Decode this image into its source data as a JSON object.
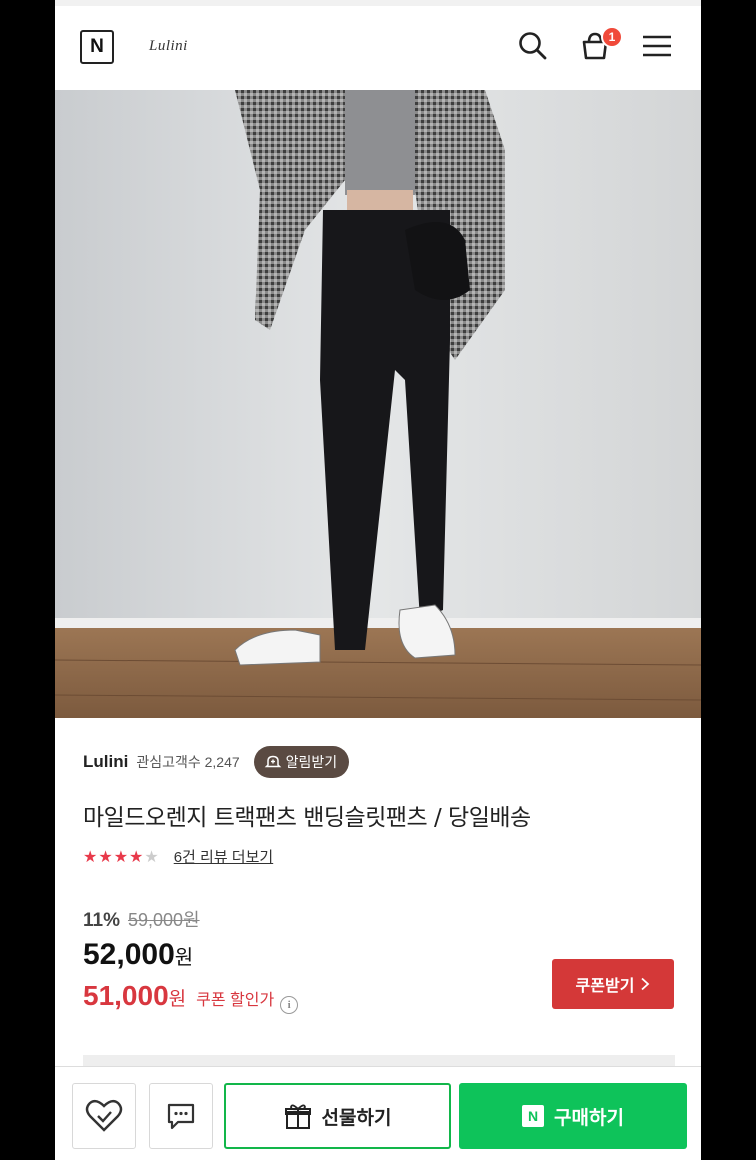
{
  "header": {
    "logo_letter": "N",
    "brand": "Lulini",
    "cart_count": "1",
    "icons": [
      "search-icon",
      "cart-icon",
      "hamburger-menu-icon"
    ]
  },
  "store": {
    "name": "Lulini",
    "followers": "관심고객수 2,247",
    "alarm_label": "알림받기"
  },
  "product": {
    "title": "마일드오렌지 트랙팬츠 밴딩슬릿팬츠 / 당일배송",
    "rating": 4.5,
    "rating_max": 5,
    "review_link": "6건 리뷰 더보기",
    "discount_rate": "11%",
    "original_price": "59,000원",
    "price_value": "52,000",
    "price_unit": "원",
    "coupon_price_value": "51,000",
    "coupon_price_unit": "원",
    "coupon_label": "쿠폰 할인가",
    "info_glyph": "i",
    "coupon_button": "쿠폰받기"
  },
  "bottom_bar": {
    "gift_label": "선물하기",
    "buy_logo": "N",
    "buy_label": "구매하기"
  },
  "colors": {
    "accent_green": "#0ec35a",
    "coupon_red": "#d43838",
    "alarm_brown": "#5a4a42",
    "badge_red": "#f04a3a"
  }
}
